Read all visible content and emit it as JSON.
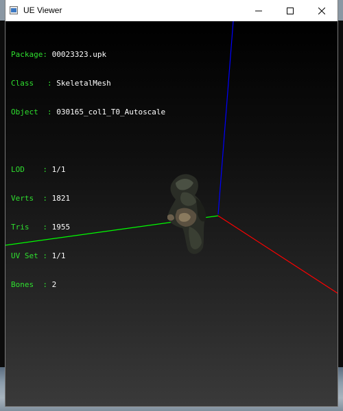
{
  "window": {
    "title": "UE Viewer"
  },
  "info": {
    "package": {
      "label": "Package: ",
      "value": "00023323.upk"
    },
    "class": {
      "label": "Class   : ",
      "value": "SkeletalMesh"
    },
    "object": {
      "label": "Object  : ",
      "value": "030165_col1_T0_Autoscale"
    },
    "lod": {
      "label": "LOD    : ",
      "value": "1/1"
    },
    "verts": {
      "label": "Verts  : ",
      "value": "1821"
    },
    "tris": {
      "label": "Tris   : ",
      "value": "1955"
    },
    "uvset": {
      "label": "UV Set : ",
      "value": "1/1"
    },
    "bones": {
      "label": "Bones  : ",
      "value": "2"
    }
  },
  "axes": {
    "x_color": "#ff0000",
    "y_color": "#00ff00",
    "z_color": "#0000ff"
  },
  "icons": {
    "minimize": "minimize-icon",
    "maximize": "maximize-icon",
    "close": "close-icon",
    "app": "app-icon"
  }
}
